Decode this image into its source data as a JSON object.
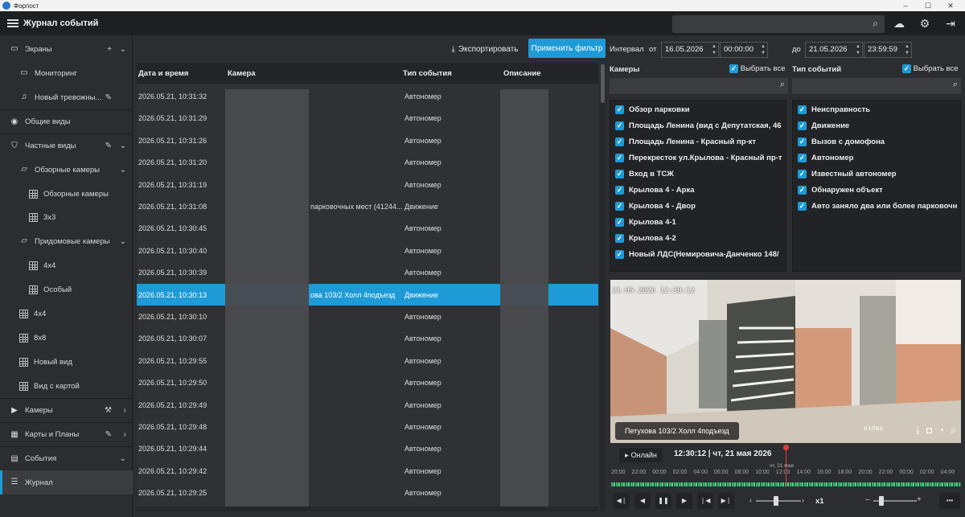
{
  "window": {
    "title": "Форпост",
    "controls": [
      "–",
      "☐",
      "✕"
    ]
  },
  "header": {
    "title": "Журнал событий",
    "search_placeholder": ""
  },
  "sidebar": {
    "items": [
      {
        "label": "Экраны"
      },
      {
        "label": "Мониторинг"
      },
      {
        "label": "Новый тревожны..."
      },
      {
        "label": "Общие виды"
      },
      {
        "label": "Частные виды"
      },
      {
        "label": "Обзорные камеры"
      },
      {
        "label": "Обзорные камеры"
      },
      {
        "label": "3x3"
      },
      {
        "label": "Придомовые камеры"
      },
      {
        "label": "4x4"
      },
      {
        "label": "Особый"
      },
      {
        "label": "4x4"
      },
      {
        "label": "8x8"
      },
      {
        "label": "Новый вид"
      },
      {
        "label": "Вид с картой"
      },
      {
        "label": "Камеры"
      },
      {
        "label": "Карты и Планы"
      },
      {
        "label": "События"
      },
      {
        "label": "Журнал"
      }
    ]
  },
  "toolbar": {
    "export_label": "Экспортировать",
    "apply_label": "Применить фильтр"
  },
  "table": {
    "columns": [
      "Дата и время",
      "Камера",
      "Тип события",
      "Описание"
    ],
    "rows": [
      {
        "time": "2026.05.21, 10:31:32",
        "camera": "",
        "type": "Автономер"
      },
      {
        "time": "2026.05.21, 10:31:29",
        "camera": "",
        "type": "Автономер"
      },
      {
        "time": "2026.05.21, 10:31:26",
        "camera": "",
        "type": "Автономер"
      },
      {
        "time": "2026.05.21, 10:31:20",
        "camera": "",
        "type": "Автономер"
      },
      {
        "time": "2026.05.21, 10:31:19",
        "camera": "",
        "type": "Автономер"
      },
      {
        "time": "2026.05.21, 10:31:08",
        "camera": "парковочных мест (41244...",
        "type": "Движение"
      },
      {
        "time": "2026.05.21, 10:30:45",
        "camera": "",
        "type": "Автономер"
      },
      {
        "time": "2026.05.21, 10:30:40",
        "camera": "",
        "type": "Автономер"
      },
      {
        "time": "2026.05.21, 10:30:39",
        "camera": "",
        "type": "Автономер"
      },
      {
        "time": "2026.05.21, 10:30:13",
        "camera": "ова 103/2 Холл 4подъезд",
        "type": "Движение"
      },
      {
        "time": "2026.05.21, 10:30:10",
        "camera": "",
        "type": "Автономер"
      },
      {
        "time": "2026.05.21, 10:30:07",
        "camera": "",
        "type": "Автономер"
      },
      {
        "time": "2026.05.21, 10:29:55",
        "camera": "",
        "type": "Автономер"
      },
      {
        "time": "2026.05.21, 10:29:50",
        "camera": "",
        "type": "Автономер"
      },
      {
        "time": "2026.05.21, 10:29:49",
        "camera": "",
        "type": "Автономер"
      },
      {
        "time": "2026.05.21, 10:29:48",
        "camera": "",
        "type": "Автономер"
      },
      {
        "time": "2026.05.21, 10:29:44",
        "camera": "",
        "type": "Автономер"
      },
      {
        "time": "2026.05.21, 10:29:42",
        "camera": "",
        "type": "Автономер"
      },
      {
        "time": "2026.05.21, 10:29:25",
        "camera": "",
        "type": "Автономер"
      }
    ]
  },
  "filters": {
    "interval_label": "Интервал",
    "from_label": "от",
    "to_label": "до",
    "from_date": "16.05.2026",
    "from_time": "00:00:00",
    "to_date": "21.05.2026",
    "to_time": "23:59:59",
    "cameras_label": "Камеры",
    "types_label": "Тип событий",
    "select_all": "Выбрать все",
    "cameras": [
      "Обзор парковки",
      "Площадь Ленина (вид с Депутатская, 46",
      "Площадь Ленина - Красный пр-кт",
      "Перекресток ул.Крылова - Красный пр-т",
      "Вход в ТСЖ",
      "Крылова 4 - Арка",
      "Крылова 4 - Двор",
      "Крылова 4-1",
      "Крылова 4-2",
      "Новый ЛДС(Немировича-Данченко 148/"
    ],
    "types": [
      "Неисправность",
      "Движение",
      "Вызов с домофона",
      "Автономер",
      "Известный автономер",
      "Обнаружен объект",
      "Авто заняло два или более парковочн"
    ]
  },
  "video": {
    "timestamp": "21-05-2026 12:30:12",
    "caption": "Петухова 103/2 Холл 4подъезд",
    "watermark": "video"
  },
  "timeline": {
    "online_label": "Онлайн",
    "current": "12:30:12 | чт, 21 мая 2026",
    "day_label": "чт, 21 мая",
    "ticks": [
      "20:00",
      "22:00",
      "00:00",
      "02:00",
      "04:00",
      "06:00",
      "08:00",
      "10:00",
      "12:00",
      "14:00",
      "16:00",
      "18:00",
      "20:00",
      "22:00",
      "00:00",
      "02:00",
      "04:00"
    ],
    "speed": "x1"
  },
  "colors": {
    "accent": "#1e9bd7",
    "bg": "#2b2d30",
    "header": "#1e1f21"
  }
}
